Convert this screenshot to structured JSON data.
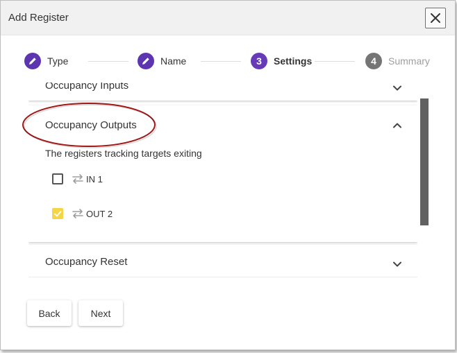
{
  "dialog": {
    "title": "Add Register"
  },
  "stepper": {
    "steps": [
      {
        "label": "Type",
        "state": "done",
        "icon": "pencil-icon"
      },
      {
        "label": "Name",
        "state": "done",
        "icon": "pencil-icon"
      },
      {
        "label": "Settings",
        "state": "active",
        "number": "3"
      },
      {
        "label": "Summary",
        "state": "pending",
        "number": "4"
      }
    ]
  },
  "panels": {
    "inputs": {
      "header": "Occupancy Inputs",
      "expanded": false
    },
    "outputs": {
      "header": "Occupancy Outputs",
      "expanded": true,
      "description": "The registers tracking targets exiting",
      "items": [
        {
          "label": "IN 1",
          "checked": false
        },
        {
          "label": "OUT 2",
          "checked": true
        }
      ]
    },
    "reset": {
      "header": "Occupancy Reset",
      "expanded": false
    }
  },
  "buttons": {
    "back": "Back",
    "next": "Next"
  },
  "colors": {
    "accent": "#673ab7",
    "done_step": "#5e35b1",
    "pending_step": "#757575",
    "checked_box": "#f5d547",
    "highlight": "#a01818",
    "scrollbar": "#616161"
  }
}
